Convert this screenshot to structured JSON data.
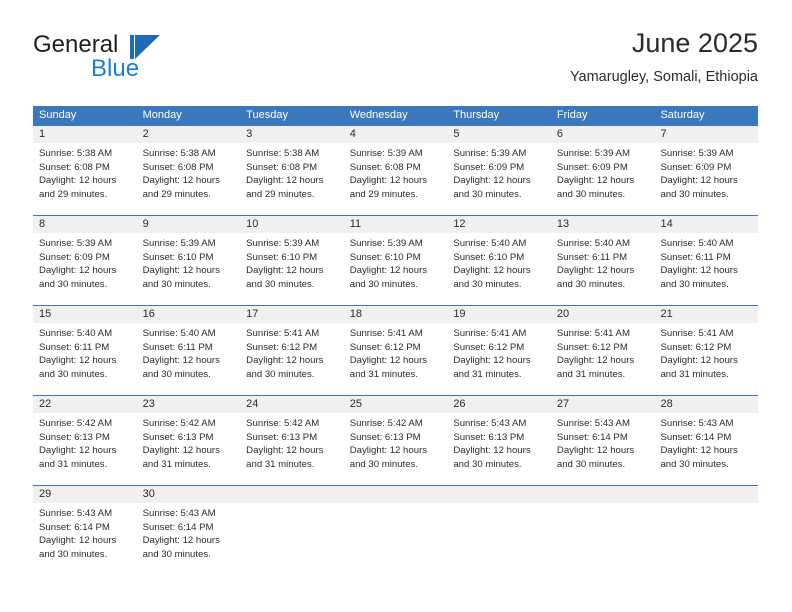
{
  "brand": {
    "name_top": "General",
    "name_bottom": "Blue",
    "mark": "blue-triangle-logo",
    "color_primary": "#1b7fd4",
    "color_text": "#231f20"
  },
  "header": {
    "title": "June 2025",
    "subtitle": "Yamarugley, Somali, Ethiopia"
  },
  "theme": {
    "header_bar": "#3b77bc",
    "daynum_band": "#f0f0f0",
    "text": "#2b2b2b"
  },
  "weekdays": [
    "Sunday",
    "Monday",
    "Tuesday",
    "Wednesday",
    "Thursday",
    "Friday",
    "Saturday"
  ],
  "weeks": [
    {
      "days": [
        {
          "num": "1",
          "sunrise": "Sunrise: 5:38 AM",
          "sunset": "Sunset: 6:08 PM",
          "daylight1": "Daylight: 12 hours",
          "daylight2": "and 29 minutes."
        },
        {
          "num": "2",
          "sunrise": "Sunrise: 5:38 AM",
          "sunset": "Sunset: 6:08 PM",
          "daylight1": "Daylight: 12 hours",
          "daylight2": "and 29 minutes."
        },
        {
          "num": "3",
          "sunrise": "Sunrise: 5:38 AM",
          "sunset": "Sunset: 6:08 PM",
          "daylight1": "Daylight: 12 hours",
          "daylight2": "and 29 minutes."
        },
        {
          "num": "4",
          "sunrise": "Sunrise: 5:39 AM",
          "sunset": "Sunset: 6:08 PM",
          "daylight1": "Daylight: 12 hours",
          "daylight2": "and 29 minutes."
        },
        {
          "num": "5",
          "sunrise": "Sunrise: 5:39 AM",
          "sunset": "Sunset: 6:09 PM",
          "daylight1": "Daylight: 12 hours",
          "daylight2": "and 30 minutes."
        },
        {
          "num": "6",
          "sunrise": "Sunrise: 5:39 AM",
          "sunset": "Sunset: 6:09 PM",
          "daylight1": "Daylight: 12 hours",
          "daylight2": "and 30 minutes."
        },
        {
          "num": "7",
          "sunrise": "Sunrise: 5:39 AM",
          "sunset": "Sunset: 6:09 PM",
          "daylight1": "Daylight: 12 hours",
          "daylight2": "and 30 minutes."
        }
      ]
    },
    {
      "days": [
        {
          "num": "8",
          "sunrise": "Sunrise: 5:39 AM",
          "sunset": "Sunset: 6:09 PM",
          "daylight1": "Daylight: 12 hours",
          "daylight2": "and 30 minutes."
        },
        {
          "num": "9",
          "sunrise": "Sunrise: 5:39 AM",
          "sunset": "Sunset: 6:10 PM",
          "daylight1": "Daylight: 12 hours",
          "daylight2": "and 30 minutes."
        },
        {
          "num": "10",
          "sunrise": "Sunrise: 5:39 AM",
          "sunset": "Sunset: 6:10 PM",
          "daylight1": "Daylight: 12 hours",
          "daylight2": "and 30 minutes."
        },
        {
          "num": "11",
          "sunrise": "Sunrise: 5:39 AM",
          "sunset": "Sunset: 6:10 PM",
          "daylight1": "Daylight: 12 hours",
          "daylight2": "and 30 minutes."
        },
        {
          "num": "12",
          "sunrise": "Sunrise: 5:40 AM",
          "sunset": "Sunset: 6:10 PM",
          "daylight1": "Daylight: 12 hours",
          "daylight2": "and 30 minutes."
        },
        {
          "num": "13",
          "sunrise": "Sunrise: 5:40 AM",
          "sunset": "Sunset: 6:11 PM",
          "daylight1": "Daylight: 12 hours",
          "daylight2": "and 30 minutes."
        },
        {
          "num": "14",
          "sunrise": "Sunrise: 5:40 AM",
          "sunset": "Sunset: 6:11 PM",
          "daylight1": "Daylight: 12 hours",
          "daylight2": "and 30 minutes."
        }
      ]
    },
    {
      "days": [
        {
          "num": "15",
          "sunrise": "Sunrise: 5:40 AM",
          "sunset": "Sunset: 6:11 PM",
          "daylight1": "Daylight: 12 hours",
          "daylight2": "and 30 minutes."
        },
        {
          "num": "16",
          "sunrise": "Sunrise: 5:40 AM",
          "sunset": "Sunset: 6:11 PM",
          "daylight1": "Daylight: 12 hours",
          "daylight2": "and 30 minutes."
        },
        {
          "num": "17",
          "sunrise": "Sunrise: 5:41 AM",
          "sunset": "Sunset: 6:12 PM",
          "daylight1": "Daylight: 12 hours",
          "daylight2": "and 30 minutes."
        },
        {
          "num": "18",
          "sunrise": "Sunrise: 5:41 AM",
          "sunset": "Sunset: 6:12 PM",
          "daylight1": "Daylight: 12 hours",
          "daylight2": "and 31 minutes."
        },
        {
          "num": "19",
          "sunrise": "Sunrise: 5:41 AM",
          "sunset": "Sunset: 6:12 PM",
          "daylight1": "Daylight: 12 hours",
          "daylight2": "and 31 minutes."
        },
        {
          "num": "20",
          "sunrise": "Sunrise: 5:41 AM",
          "sunset": "Sunset: 6:12 PM",
          "daylight1": "Daylight: 12 hours",
          "daylight2": "and 31 minutes."
        },
        {
          "num": "21",
          "sunrise": "Sunrise: 5:41 AM",
          "sunset": "Sunset: 6:12 PM",
          "daylight1": "Daylight: 12 hours",
          "daylight2": "and 31 minutes."
        }
      ]
    },
    {
      "days": [
        {
          "num": "22",
          "sunrise": "Sunrise: 5:42 AM",
          "sunset": "Sunset: 6:13 PM",
          "daylight1": "Daylight: 12 hours",
          "daylight2": "and 31 minutes."
        },
        {
          "num": "23",
          "sunrise": "Sunrise: 5:42 AM",
          "sunset": "Sunset: 6:13 PM",
          "daylight1": "Daylight: 12 hours",
          "daylight2": "and 31 minutes."
        },
        {
          "num": "24",
          "sunrise": "Sunrise: 5:42 AM",
          "sunset": "Sunset: 6:13 PM",
          "daylight1": "Daylight: 12 hours",
          "daylight2": "and 31 minutes."
        },
        {
          "num": "25",
          "sunrise": "Sunrise: 5:42 AM",
          "sunset": "Sunset: 6:13 PM",
          "daylight1": "Daylight: 12 hours",
          "daylight2": "and 30 minutes."
        },
        {
          "num": "26",
          "sunrise": "Sunrise: 5:43 AM",
          "sunset": "Sunset: 6:13 PM",
          "daylight1": "Daylight: 12 hours",
          "daylight2": "and 30 minutes."
        },
        {
          "num": "27",
          "sunrise": "Sunrise: 5:43 AM",
          "sunset": "Sunset: 6:14 PM",
          "daylight1": "Daylight: 12 hours",
          "daylight2": "and 30 minutes."
        },
        {
          "num": "28",
          "sunrise": "Sunrise: 5:43 AM",
          "sunset": "Sunset: 6:14 PM",
          "daylight1": "Daylight: 12 hours",
          "daylight2": "and 30 minutes."
        }
      ]
    },
    {
      "days": [
        {
          "num": "29",
          "sunrise": "Sunrise: 5:43 AM",
          "sunset": "Sunset: 6:14 PM",
          "daylight1": "Daylight: 12 hours",
          "daylight2": "and 30 minutes."
        },
        {
          "num": "30",
          "sunrise": "Sunrise: 5:43 AM",
          "sunset": "Sunset: 6:14 PM",
          "daylight1": "Daylight: 12 hours",
          "daylight2": "and 30 minutes."
        },
        {
          "num": "",
          "sunrise": "",
          "sunset": "",
          "daylight1": "",
          "daylight2": ""
        },
        {
          "num": "",
          "sunrise": "",
          "sunset": "",
          "daylight1": "",
          "daylight2": ""
        },
        {
          "num": "",
          "sunrise": "",
          "sunset": "",
          "daylight1": "",
          "daylight2": ""
        },
        {
          "num": "",
          "sunrise": "",
          "sunset": "",
          "daylight1": "",
          "daylight2": ""
        },
        {
          "num": "",
          "sunrise": "",
          "sunset": "",
          "daylight1": "",
          "daylight2": ""
        }
      ]
    }
  ]
}
